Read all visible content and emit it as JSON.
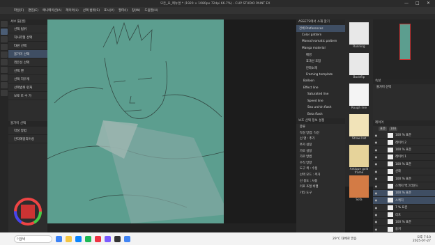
{
  "window": {
    "title": "모든_요_메뉴얼 * (1920 × 1080px 72dpi 66.7%) - CLIP STUDIO PAINT EX",
    "controls": [
      "—",
      "□",
      "✕"
    ]
  },
  "menu": {
    "items": [
      "파일(F)",
      "편집(E)",
      "애니메이션(A)",
      "레이어(L)",
      "선택 범위(S)",
      "표시(V)",
      "필터(I)",
      "창(W)",
      "도움말(H)"
    ]
  },
  "subtool": {
    "header": "서브 툴[펜]",
    "items": [
      {
        "label": "선택 범위",
        "sel": false
      },
      {
        "label": "직사각형 선택",
        "sel": false
      },
      {
        "label": "타원 선택",
        "sel": false
      },
      {
        "label": "올가미 선택",
        "sel": true
      },
      {
        "label": "꺾은선 선택",
        "sel": false
      },
      {
        "label": "선택 펜",
        "sel": false
      },
      {
        "label": "선택 지우개",
        "sel": false
      },
      {
        "label": "선택범위 런처",
        "sel": false
      },
      {
        "label": "보로 토 수 가",
        "sel": false
      }
    ],
    "detail_header": "올가미 선택",
    "rows": [
      "작성 방법",
      "안티에일리어싱"
    ]
  },
  "materials": {
    "header": "ASSETS에서 소재 찾기",
    "items": [
      "전체 Preferences",
      "Color pattern",
      "Monochromatic pattern",
      "Manga material",
      "배경",
      "효과선 조합",
      "만화소재",
      "Framing template",
      "Balloon",
      "Effect line",
      "Saturated line",
      "Speed line",
      "Sea urchin flash",
      "Beta flash"
    ],
    "thumbs": [
      "Running",
      "Backflip",
      "Rough line",
      "Straw hat",
      "Antique gold frame",
      "Sofa"
    ]
  },
  "subtool_detail": {
    "header": "보조 선택 정보 설정",
    "rows": [
      "종류",
      "작성 방법: 직선",
      "선 명 : 추가",
      "추가 설정",
      "가로 설정",
      "가로 방법",
      "수직 방향",
      "도구 색 : 수정",
      "선택 모드 : 추가",
      "선 용도 : 사용",
      "리포 조절 비행",
      "기타 도구"
    ]
  },
  "props": {
    "header": "속성",
    "label": "올가미 선택"
  },
  "layers": {
    "header": "레이어",
    "blend": "표준",
    "opacity": "100",
    "items": [
      "100 % 표준",
      "레이어 2",
      "100 % 표준",
      "레이어 1",
      "100 % 표준",
      "선화",
      "100 % 표준",
      "스케치 백그라운드",
      "100 % 표준",
      "스케치",
      "7 % 표준",
      "러프",
      "100 % 표준",
      "용지"
    ]
  },
  "taskbar": {
    "search": "검색",
    "time": "오후 7:10",
    "date": "2025-07-27",
    "weather": "29°C 대체로 맑음"
  },
  "colors": {
    "canvas": "#5c9e8f",
    "accent": "#3f4e63"
  }
}
